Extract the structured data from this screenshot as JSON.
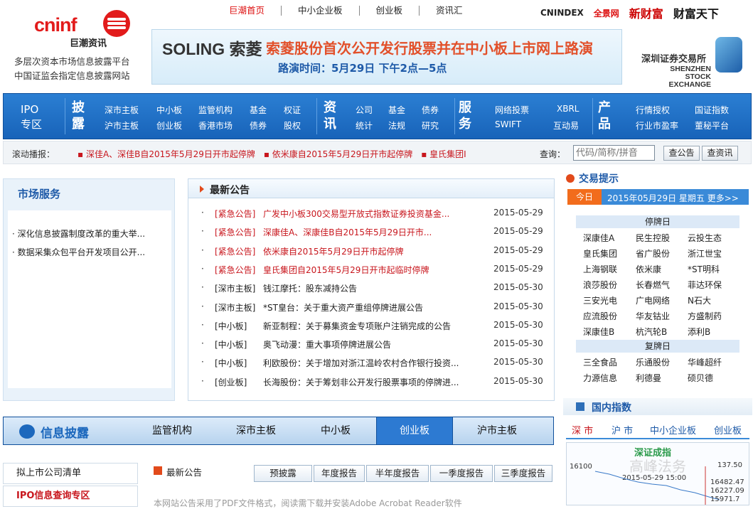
{
  "logo": {
    "en": "cninf",
    "zh": "巨潮资讯"
  },
  "tagline": [
    "多层次资本市场信息披露平台",
    "中国证监会指定信息披露网站"
  ],
  "topnav": [
    "巨潮首页",
    "中小企业板",
    "创业板",
    "资讯汇"
  ],
  "partners": [
    "CNINDEX",
    "全景网",
    "新财富",
    "财富天下"
  ],
  "banner": {
    "brand": "SOLING 索菱",
    "title": "索菱股份首次公开发行股票并在中小板上市网上路演",
    "time": "路演时间：5月29日 下午2点—5点"
  },
  "szse": {
    "zh": "深圳证券交易所",
    "en1": "SHENZHEN",
    "en2": "STOCK EXCHANGE"
  },
  "mainnav": {
    "ipo": [
      "IPO",
      "专区"
    ],
    "pilu": [
      "披",
      "露"
    ],
    "pilu_links": [
      "深市主板",
      "中小板",
      "监管机构",
      "基金",
      "权证",
      "沪市主板",
      "创业板",
      "香港市场",
      "债券",
      "股权"
    ],
    "zixun": [
      "资",
      "讯"
    ],
    "zixun_links": [
      "公司",
      "基金",
      "债券",
      "统计",
      "法规",
      "研究"
    ],
    "fuwu": [
      "服",
      "务"
    ],
    "fuwu_links": [
      "网络投票",
      "XBRL",
      "SWIFT",
      "互动易"
    ],
    "chanpin": [
      "产",
      "品"
    ],
    "chanpin_links": [
      "行情授权",
      "国证指数",
      "行业市盈率",
      "董秘平台"
    ]
  },
  "ticker": {
    "label": "滚动播报：",
    "items": "▪ 深佳A、深佳B自2015年5月29日开市起停牌　▪ 依米康自2015年5月29日开市起停牌　▪ 皇氏集团I",
    "query_label": "查询：",
    "placeholder": "代码/简称/拼音",
    "btn1": "查公告",
    "btn2": "查资讯"
  },
  "market": {
    "title": "市场服务",
    "items": [
      "· 深化信息披露制度改革的重大举...",
      "· 数据采集众包平台开发项目公开..."
    ]
  },
  "news": {
    "title": "最新公告",
    "rows": [
      {
        "cat": "[紧急公告]",
        "text": "广发中小板300交易型开放式指数证券投资基金...",
        "date": "2015-05-29",
        "red": true
      },
      {
        "cat": "[紧急公告]",
        "text": "深康佳A、深康佳B自2015年5月29日开市...",
        "date": "2015-05-29",
        "red": true
      },
      {
        "cat": "[紧急公告]",
        "text": "依米康自2015年5月29日开市起停牌",
        "date": "2015-05-29",
        "red": true
      },
      {
        "cat": "[紧急公告]",
        "text": "皇氏集团自2015年5月29日开市起临时停牌",
        "date": "2015-05-29",
        "red": true
      },
      {
        "cat": "[深市主板]",
        "text": "钱江摩托：股东减持公告",
        "date": "2015-05-30",
        "red": false
      },
      {
        "cat": "[深市主板]",
        "text": "*ST皇台：关于重大资产重组停牌进展公告",
        "date": "2015-05-30",
        "red": false
      },
      {
        "cat": "[中小板]",
        "text": "新亚制程：关于募集资金专项账户注销完成的公告",
        "date": "2015-05-30",
        "red": false
      },
      {
        "cat": "[中小板]",
        "text": "奥飞动漫：重大事项停牌进展公告",
        "date": "2015-05-30",
        "red": false
      },
      {
        "cat": "[中小板]",
        "text": "利欧股份：关于增加对浙江温岭农村合作银行投资...",
        "date": "2015-05-30",
        "red": false
      },
      {
        "cat": "[创业板]",
        "text": "长海股份：关于筹划非公开发行股票事项的停牌进...",
        "date": "2015-05-30",
        "red": false
      }
    ]
  },
  "trade": {
    "title": "交易提示",
    "today": "今日",
    "date": "2015年05月29日 星期五 更多>>",
    "halt_label": "停牌日",
    "halt": [
      "深康佳A",
      "民生控股",
      "云投生态",
      "皇氏集团",
      "省广股份",
      "浙江世宝",
      "上海钢联",
      "依米康",
      "*ST明科",
      "浪莎股份",
      "长春燃气",
      "菲达环保",
      "三安光电",
      "广电网络",
      "N石大",
      "应流股份",
      "华友钴业",
      "方盛制药",
      "深康佳B",
      "杭汽轮B",
      "添利B"
    ],
    "resume_label": "复牌日",
    "resume": [
      "三全食品",
      "乐通股份",
      "华峰超纤",
      "力源信息",
      "利德曼",
      "硕贝德"
    ]
  },
  "index": {
    "title": "国内指数",
    "tabs": [
      "深 市",
      "沪 市",
      "中小企业板",
      "创业板"
    ],
    "chart_title": "深证成指",
    "y_top": "16100",
    "time": "2015-05-29 15:00",
    "vals": [
      "16482.47",
      "16227.09",
      "15971.7"
    ],
    "right": "137.50",
    "watermark": "高峰法务"
  },
  "info": {
    "title": "信息披露",
    "tabs": [
      "监管机构",
      "深市主板",
      "中小板",
      "创业板",
      "沪市主板"
    ]
  },
  "bottom": {
    "list": "拟上市公司清单",
    "ipo": "IPO信息查询专区",
    "notice": "最新公告",
    "reports": [
      "预披露",
      "年度报告",
      "半年度报告",
      "一季度报告",
      "三季度报告"
    ],
    "foot": "本网站公告采用了PDF文件格式，阅读需下载并安装Adobe Acrobat Reader软件"
  },
  "colors": {
    "nav": "#1863b9",
    "accent": "#c8161d",
    "orange": "#f26c1c"
  }
}
